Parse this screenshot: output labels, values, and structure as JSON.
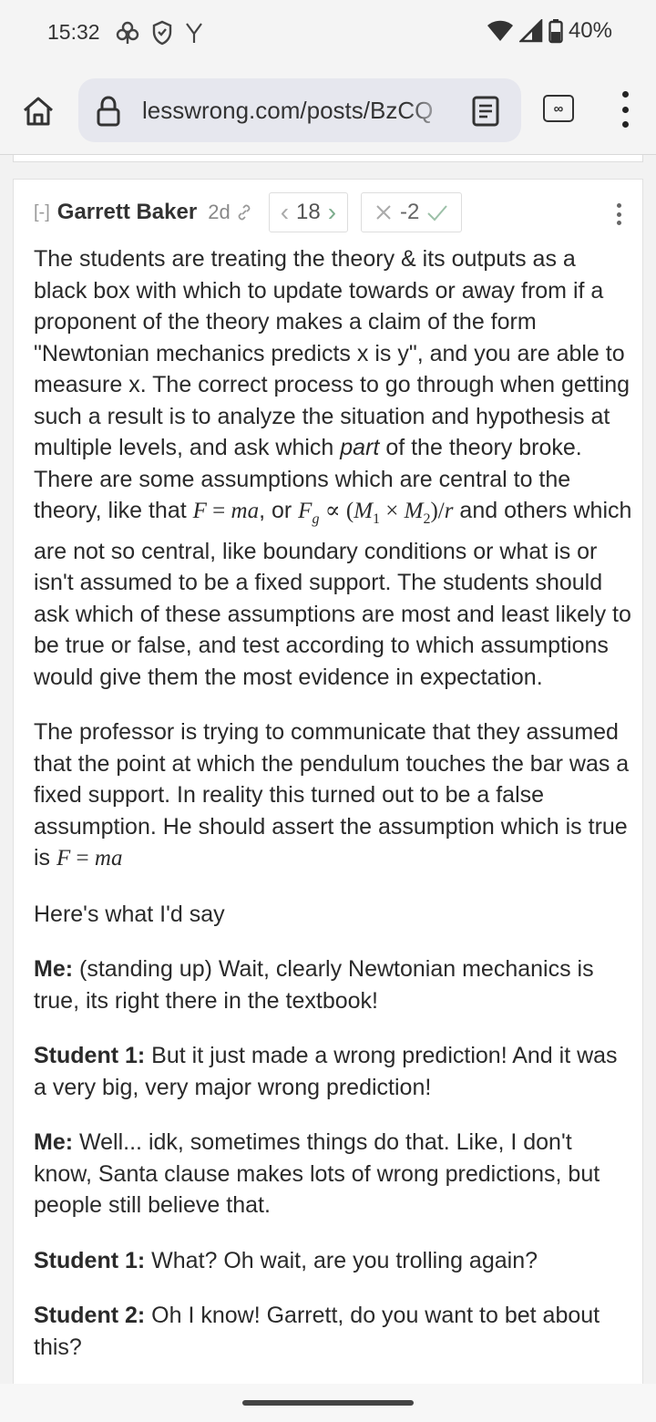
{
  "status_bar": {
    "time": "15:32",
    "battery": "40%"
  },
  "browser": {
    "url": "lesswrong.com/posts/BzCQ",
    "tabs_count": "∞"
  },
  "comment": {
    "collapse": "[-]",
    "author": "Garrett Baker",
    "age": "2d",
    "karma": "18",
    "agreement": "-2",
    "paragraphs": {
      "p1_a": "The students are treating the theory & its outputs as a black box with which to update towards or away from if a proponent of the theory makes a claim of the form \"Newtonian mechanics predicts x is y\", and you are able to measure x. The correct process to go through when getting such a result is to analyze the situation and hypothesis at multiple levels, and ask which ",
      "p1_part": "part",
      "p1_b": " of the theory broke. There are some assumptions which are central to the theory, like that ",
      "p1_c": ", or ",
      "p1_d": " and others which are not so central, like boundary conditions or what is or isn't assumed to be a fixed support. The students should ask which of these assumptions are most and least likely to be true or false, and test according to which assumptions would give them the most evidence in expectation.",
      "p2_a": "The professor is trying to communicate that they assumed that the point at which the pendulum touches the bar was a fixed support. In reality this turned out to be a false assumption. He should assert the assumption which is true is ",
      "p3": "Here's what I'd say",
      "d1_speaker": "Me:",
      "d1_text": " (standing up) Wait, clearly Newtonian mechanics is true, its right there in the textbook!",
      "d2_speaker": "Student 1:",
      "d2_text": " But it just made a wrong prediction! And it was a very big, very major wrong prediction!",
      "d3_speaker": "Me:",
      "d3_text": " Well... idk, sometimes things do that. Like, I don't know, Santa clause makes lots of wrong predictions, but people still believe that.",
      "d4_speaker": "Student 1:",
      "d4_text": " What? Oh wait, are you trolling again?",
      "d5_speaker": "Student 2:",
      "d5_text": " Oh I know! Garrett, do you want to bet about this?"
    },
    "math": {
      "F": "F",
      "eq": " = ",
      "ma": "ma",
      "Fg_F": "F",
      "Fg_sub": "g",
      "propto": " ∝ (",
      "M1": "M",
      "sub1": "1",
      "times": " × ",
      "M2": "M",
      "sub2": "2",
      "close": ")/",
      "r": "r"
    }
  }
}
